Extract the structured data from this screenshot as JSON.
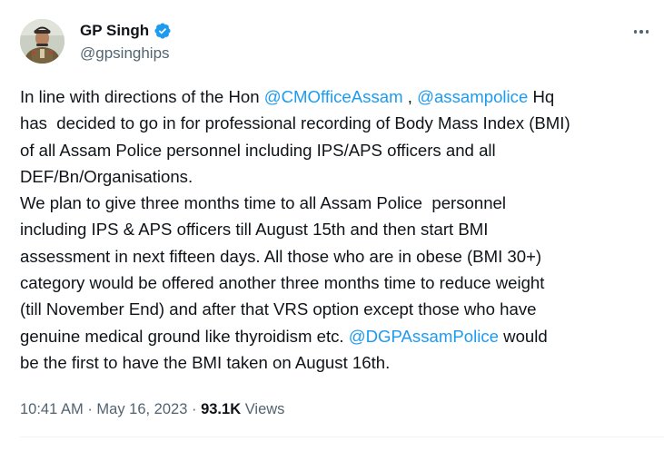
{
  "author": {
    "display_name": "GP Singh",
    "handle": "@gpsinghips",
    "verified": true,
    "avatar_icon": "profile-photo",
    "verified_icon": "verified-badge-icon",
    "verified_color": "#1d9bf0"
  },
  "more_icon": "more-options-icon",
  "tweet": {
    "lines": [
      [
        {
          "t": "In line with directions of the Hon "
        },
        {
          "t": "@CMOfficeAssam",
          "m": true
        },
        {
          "t": " , "
        },
        {
          "t": "@assampolice",
          "m": true
        },
        {
          "t": " Hq"
        }
      ],
      [
        {
          "t": "has  decided to go in for professional recording of Body Mass Index (BMI)"
        }
      ],
      [
        {
          "t": "of all Assam Police personnel including IPS/APS officers and all"
        }
      ],
      [
        {
          "t": "DEF/Bn/Organisations."
        }
      ],
      [
        {
          "t": "We plan to give three months time to all Assam Police  personnel"
        }
      ],
      [
        {
          "t": "including IPS & APS officers till August 15th and then start BMI"
        }
      ],
      [
        {
          "t": "assessment in next fifteen days. All those who are in obese (BMI 30+)"
        }
      ],
      [
        {
          "t": "category would be offered another three months time to reduce weight"
        }
      ],
      [
        {
          "t": "(till November End) and after that VRS option except those who have"
        }
      ],
      [
        {
          "t": "genuine medical ground like thyroidism etc. "
        },
        {
          "t": "@DGPAssamPolice",
          "m": true
        },
        {
          "t": " would"
        }
      ],
      [
        {
          "t": "be the first to have the BMI taken on August 16th."
        }
      ]
    ]
  },
  "meta": {
    "time": "10:41 AM",
    "separator": "·",
    "date": "May 16, 2023",
    "views_count": "93.1K",
    "views_label": "Views"
  },
  "colors": {
    "text": "#0f1419",
    "secondary": "#536471",
    "link": "#1d9bf0",
    "divider": "#eff3f4"
  }
}
